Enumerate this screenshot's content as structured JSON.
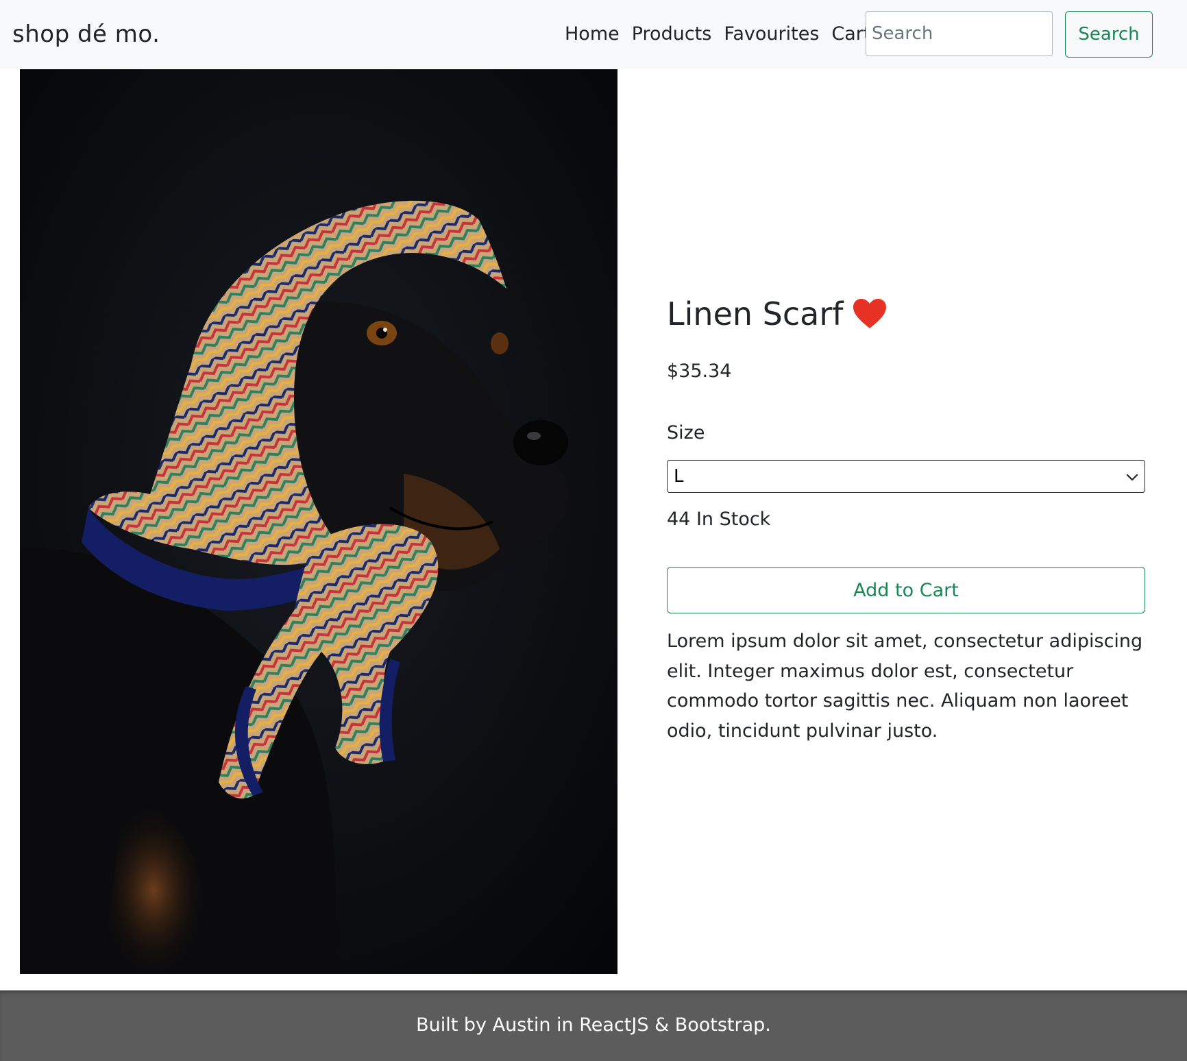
{
  "navbar": {
    "brand": "shop dé mo.",
    "links": [
      "Home",
      "Products",
      "Favourites",
      "Cart"
    ],
    "search_placeholder": "Search",
    "search_value": "",
    "search_button": "Search"
  },
  "product": {
    "title": "Linen Scarf",
    "favourite_icon": "heart-icon",
    "favourited": true,
    "price": "$35.34",
    "size_label": "Size",
    "size_selected": "L",
    "stock_text": "44 In Stock",
    "add_to_cart": "Add to Cart",
    "description": "Lorem ipsum dolor sit amet, consectetur adipiscing elit. Integer maximus dolor est, consectetur commodo tortor sagittis nec. Aliquam non laoreet odio, tincidunt pulvinar justo."
  },
  "footer": {
    "text": "Built by Austin in ReactJS & Bootstrap."
  },
  "colors": {
    "navbar_bg": "#f8f9fa",
    "accent_green": "#198754",
    "heart_red": "#e53224",
    "footer_bg": "#5c5c5c",
    "text": "#212529"
  }
}
